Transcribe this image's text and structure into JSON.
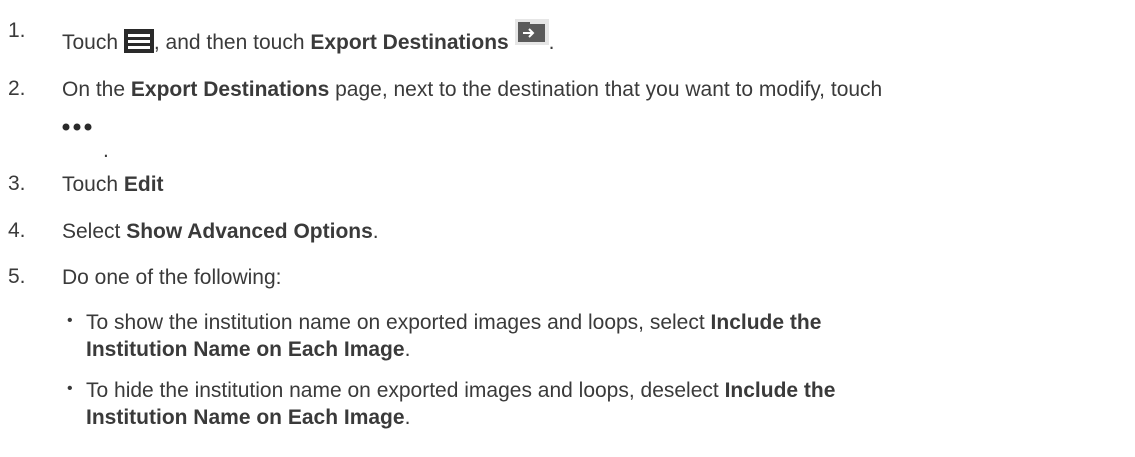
{
  "steps": [
    {
      "number": "1.",
      "pre": "Touch ",
      "mid": ", and then touch ",
      "bold": "Export Destinations",
      "post": "."
    },
    {
      "number": "2.",
      "pre": "On the ",
      "bold": "Export Destinations",
      "post": " page, next to the destination that you want to modify, touch",
      "tail": "."
    },
    {
      "number": "3.",
      "pre": "Touch ",
      "bold": "Edit"
    },
    {
      "number": "4.",
      "pre": "Select ",
      "bold": "Show Advanced Options",
      "post": "."
    },
    {
      "number": "5.",
      "pre": "Do one of the following:"
    }
  ],
  "bullets": [
    {
      "pre": "To show the institution name on exported images and loops, select ",
      "bold1": "Include the",
      "bold2": "Institution Name on Each Image",
      "post": "."
    },
    {
      "pre": "To hide the institution name on exported images and loops, deselect ",
      "bold1": "Include the",
      "bold2": "Institution Name on Each Image",
      "post": "."
    }
  ],
  "icons": {
    "menu": "hamburger-menu-icon",
    "export": "export-destinations-icon",
    "more": "more-options-icon"
  }
}
